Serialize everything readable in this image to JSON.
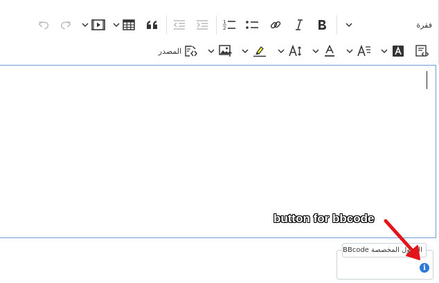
{
  "toolbar": {
    "paragraph_label": "فقرة",
    "source_label": "المصدر"
  },
  "icons": {
    "undo": "undo-icon",
    "redo": "redo-icon",
    "media": "media-embed-icon",
    "table": "table-icon",
    "quote": "block-quote-icon",
    "outdent": "outdent-icon",
    "indent": "indent-icon",
    "numbered_list": "numbered-list-icon",
    "bulleted_list": "bulleted-list-icon",
    "link": "link-icon",
    "italic": "italic-icon",
    "bold": "bold-icon",
    "more": "chevron-down-icon",
    "source": "source-editing-icon",
    "image": "insert-image-icon",
    "highlight": "highlight-icon",
    "font_size": "font-size-icon",
    "font_color": "font-color-icon",
    "font_family": "font-family-icon",
    "font_bg": "font-background-color-icon",
    "html_embed": "html-embed-icon"
  },
  "colors": {
    "editor_border": "#6d9fd6",
    "highlight": "#f5ef3a",
    "info": "#2f7ad9",
    "arrow": "#e4141b"
  },
  "bbcode": {
    "label": "الحقول المخصصة BBcode"
  },
  "annotation": {
    "text": "button for bbcode"
  }
}
